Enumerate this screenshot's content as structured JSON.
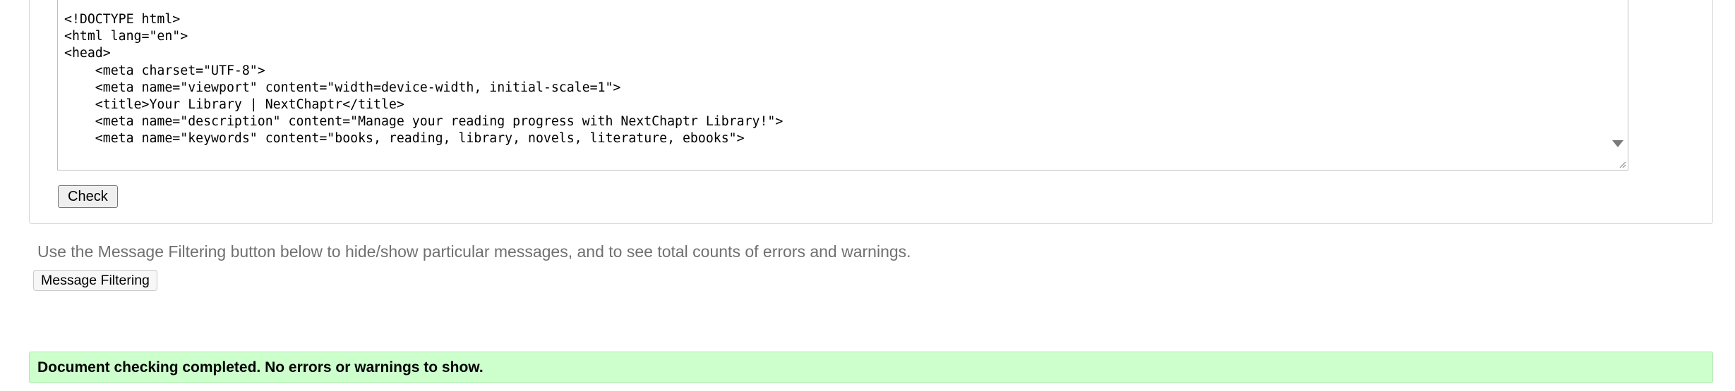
{
  "form": {
    "source_lines": [
      "<!DOCTYPE html>",
      "<html lang=\"en\">",
      "<head>",
      "    <meta charset=\"UTF-8\">",
      "    <meta name=\"viewport\" content=\"width=device-width, initial-scale=1\">",
      "    <title>Your Library | NextChaptr</title>",
      "    <meta name=\"description\" content=\"Manage your reading progress with NextChaptr Library!\">",
      "    <meta name=\"keywords\" content=\"books, reading, library, novels, literature, ebooks\">"
    ],
    "check_label": "Check"
  },
  "filtering": {
    "hint": "Use the Message Filtering button below to hide/show particular messages, and to see total counts of errors and warnings.",
    "button_label": "Message Filtering"
  },
  "result": {
    "message": "Document checking completed. No errors or warnings to show."
  },
  "icons": {
    "scroll": "scroll-down-arrow-icon",
    "resize": "resize-grip-icon"
  },
  "colors": {
    "success_background": "#ccffcc",
    "hint_text": "#707070"
  }
}
